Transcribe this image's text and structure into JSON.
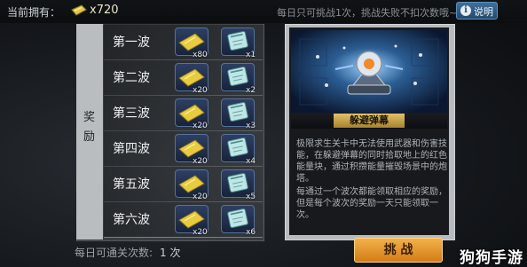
{
  "header": {
    "owned_label": "当前拥有：",
    "owned_count": "x720",
    "notice": "每日只可挑战1次，挑战失败不扣次数哦~",
    "help_label": "说明",
    "help_glyph": "i"
  },
  "rewards": {
    "label_chars": [
      "奖",
      "励"
    ],
    "waves": [
      {
        "name": "第一波",
        "gold_qty": "x80",
        "xp_qty": "x1"
      },
      {
        "name": "第二波",
        "gold_qty": "x20",
        "xp_qty": "x2"
      },
      {
        "name": "第三波",
        "gold_qty": "x20",
        "xp_qty": "x3"
      },
      {
        "name": "第四波",
        "gold_qty": "x20",
        "xp_qty": "x4"
      },
      {
        "name": "第五波",
        "gold_qty": "x20",
        "xp_qty": "x5"
      },
      {
        "name": "第六波",
        "gold_qty": "x20",
        "xp_qty": "x6"
      }
    ],
    "daily_label": "每日可通关次数:",
    "daily_count": "1 次"
  },
  "skill": {
    "title": "躲避弹幕",
    "desc_1": "极限求生关卡中无法使用武器和伤害技能，在躲避弹幕的同时拾取地上的红色能量块，通过积攒能量摧毁场景中的炮塔。",
    "desc_2": "每通过一个波次都能领取相应的奖励，但是每个波次的奖励一天只能领取一次。"
  },
  "actions": {
    "challenge_label": "挑 战"
  },
  "watermark": "狗狗手游",
  "colors": {
    "accent": "#e2c16a",
    "button": "#e89a30"
  }
}
